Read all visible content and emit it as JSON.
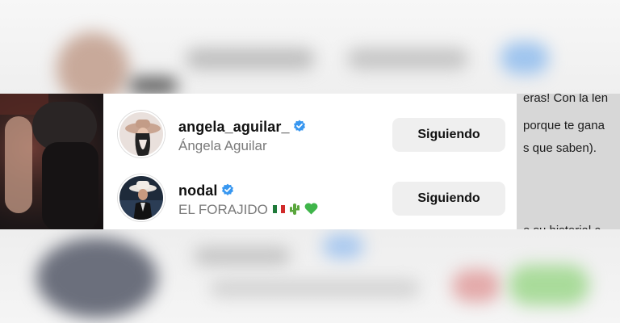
{
  "panel": {
    "accounts": [
      {
        "username": "angela_aguilar_",
        "full_name": "Ángela Aguilar",
        "verified": true,
        "button_label": "Siguiendo"
      },
      {
        "username": "nodal",
        "full_name": "EL FORAJIDO",
        "verified": true,
        "emojis": [
          "mexico-flag-icon",
          "cactus-icon",
          "green-heart-icon"
        ],
        "button_label": "Siguiendo"
      }
    ]
  },
  "background_text": {
    "lines": [
      "eras! Con la len",
      "porque te gana",
      "s que saben).",
      "",
      "",
      "e su historial c"
    ]
  },
  "colors": {
    "verified_badge": "#3897f0",
    "button_bg": "#efefef",
    "secondary_text": "#7a7a7a"
  }
}
